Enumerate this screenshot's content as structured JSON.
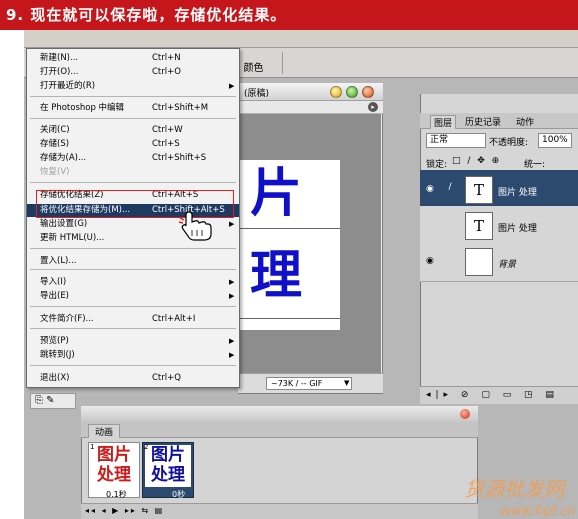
{
  "banner": {
    "text": "9. 现在就可以保存啦，存储优化结果。",
    "color": "#c5161c"
  },
  "options_bar": {
    "color_label": "b 颜色"
  },
  "document": {
    "title": "(原稿)",
    "chars": [
      "片",
      "理"
    ],
    "status": "~73K / -- GIF"
  },
  "menu": {
    "items": [
      {
        "label": "新建(N)...",
        "shortcut": "Ctrl+N",
        "submenu": false,
        "disabled": false,
        "highlighted": false
      },
      {
        "label": "打开(O)...",
        "shortcut": "Ctrl+O",
        "submenu": false,
        "disabled": false,
        "highlighted": false
      },
      {
        "label": "打开最近的(R)",
        "shortcut": "",
        "submenu": true,
        "disabled": false,
        "highlighted": false
      },
      {
        "label": "在 Photoshop 中编辑",
        "shortcut": "Ctrl+Shift+M",
        "submenu": false,
        "disabled": false,
        "highlighted": false
      },
      {
        "label": "关闭(C)",
        "shortcut": "Ctrl+W",
        "submenu": false,
        "disabled": false,
        "highlighted": false
      },
      {
        "label": "存储(S)",
        "shortcut": "Ctrl+S",
        "submenu": false,
        "disabled": false,
        "highlighted": false
      },
      {
        "label": "存储为(A)...",
        "shortcut": "Ctrl+Shift+S",
        "submenu": false,
        "disabled": false,
        "highlighted": false
      },
      {
        "label": "恢复(V)",
        "shortcut": "",
        "submenu": false,
        "disabled": true,
        "highlighted": false
      },
      {
        "label": "存储优化结果(Z)",
        "shortcut": "Ctrl+Alt+S",
        "submenu": false,
        "disabled": false,
        "highlighted": false
      },
      {
        "label": "将优化结果存储为(M)...",
        "shortcut": "Ctrl+Shift+Alt+S",
        "submenu": false,
        "disabled": false,
        "highlighted": true
      },
      {
        "label": "输出设置(G)",
        "shortcut": "",
        "submenu": true,
        "disabled": false,
        "highlighted": false
      },
      {
        "label": "更新 HTML(U)...",
        "shortcut": "",
        "submenu": false,
        "disabled": false,
        "highlighted": false
      },
      {
        "label": "置入(L)...",
        "shortcut": "",
        "submenu": false,
        "disabled": false,
        "highlighted": false
      },
      {
        "label": "导入(I)",
        "shortcut": "",
        "submenu": true,
        "disabled": false,
        "highlighted": false
      },
      {
        "label": "导出(E)",
        "shortcut": "",
        "submenu": true,
        "disabled": false,
        "highlighted": false
      },
      {
        "label": "文件简介(F)...",
        "shortcut": "Ctrl+Alt+I",
        "submenu": false,
        "disabled": false,
        "highlighted": false
      },
      {
        "label": "预览(P)",
        "shortcut": "",
        "submenu": true,
        "disabled": false,
        "highlighted": false
      },
      {
        "label": "跳转到(J)",
        "shortcut": "",
        "submenu": true,
        "disabled": false,
        "highlighted": false
      },
      {
        "label": "退出(X)",
        "shortcut": "Ctrl+Q",
        "submenu": false,
        "disabled": false,
        "highlighted": false
      }
    ]
  },
  "layers_panel": {
    "tabs": [
      "图层",
      "历史记录",
      "动作"
    ],
    "blend_mode": "正常",
    "opacity_label": "不透明度:",
    "opacity_value": "100%",
    "lock_label": "锁定:",
    "unify_label": "统一:",
    "layers": [
      {
        "name": "图片 处理",
        "thumb": "T"
      },
      {
        "name": "图片 处理",
        "thumb": "T"
      },
      {
        "name": "背景",
        "thumb": ""
      }
    ]
  },
  "animation_panel": {
    "tab": "动画",
    "frames": [
      {
        "number": "1",
        "text_line1": "图片",
        "text_line2": "处理",
        "delay": "0.1秒"
      },
      {
        "number": "2",
        "text_line1": "图片",
        "text_line2": "处理",
        "delay": "0秒"
      }
    ]
  }
}
